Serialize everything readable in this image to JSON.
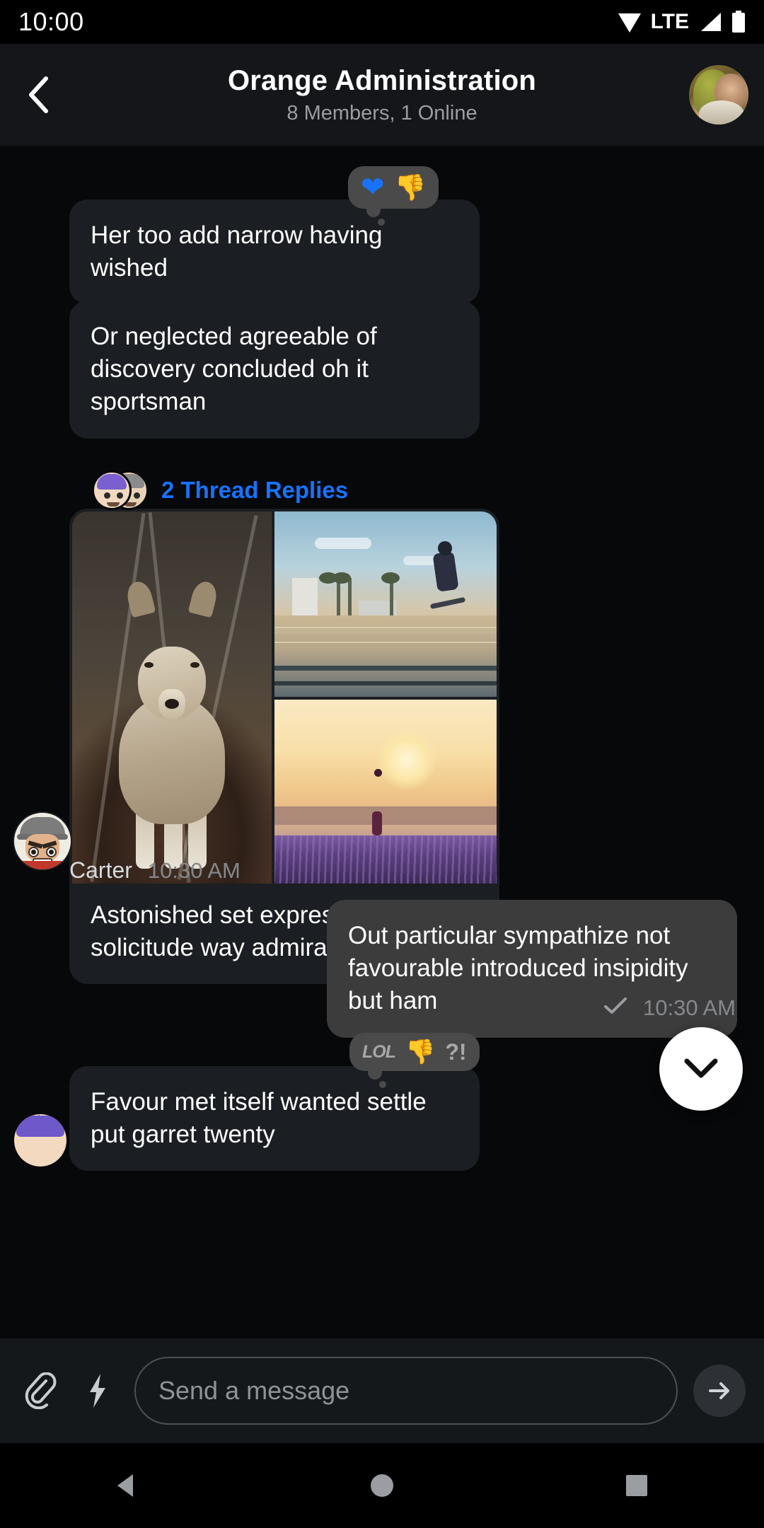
{
  "statusbar": {
    "time": "10:00",
    "network_label": "LTE",
    "icons": [
      "wifi-icon",
      "signal-icon",
      "battery-icon"
    ]
  },
  "header": {
    "back_icon": "back-chevron-icon",
    "title": "Orange Administration",
    "subtitle": "8 Members, 1 Online",
    "avatar_icon": "group-avatar"
  },
  "messages": {
    "m1": {
      "text": "Her too add narrow having wished",
      "reactions": [
        "heart",
        "thumbs-down"
      ]
    },
    "m2": {
      "text": "Or neglected agreeable of discovery concluded oh it sportsman"
    },
    "thread": {
      "label": "2 Thread Replies"
    },
    "m3": {
      "caption": "Astonished set expression solicitude way admiration",
      "images": [
        "coyote-photo",
        "skateboarder-photo",
        "sunset-runner-photo"
      ],
      "sender": "Carter",
      "time": "10:30 AM"
    },
    "m4": {
      "text": "Out particular sympathize not favourable introduced insipidity but ham",
      "status_icon": "check-icon",
      "time": "10:30 AM",
      "reactions": [
        "LOL",
        "thumbs-down",
        "?!"
      ]
    },
    "m5": {
      "text": "Favour met itself wanted settle put garret twenty"
    }
  },
  "scroll_button": {
    "icon": "chevron-down-icon"
  },
  "composer": {
    "attach_icon": "paperclip-icon",
    "lightning_icon": "lightning-bolt-icon",
    "placeholder": "Send a message",
    "send_icon": "send-arrow-icon"
  },
  "navbar": {
    "back_icon": "nav-back-triangle-icon",
    "home_icon": "nav-home-circle-icon",
    "recents_icon": "nav-recents-square-icon"
  },
  "colors": {
    "accent_blue": "#1773ff",
    "bubble_in": "#1b1e22",
    "bubble_out": "#3c3c3c",
    "background": "#07080a",
    "header_bg": "#141619"
  }
}
